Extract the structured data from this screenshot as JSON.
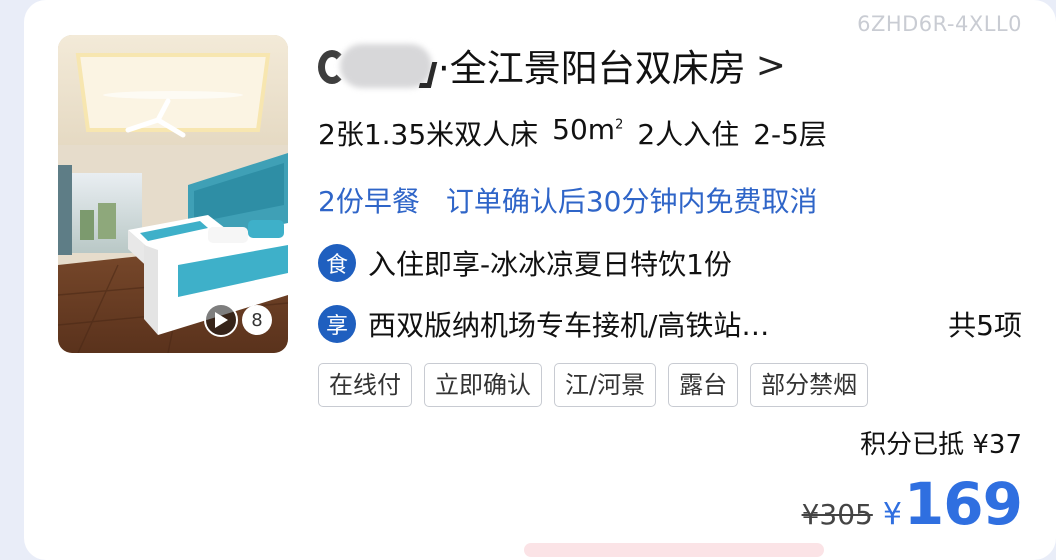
{
  "watermark": "6ZHD6R-4XLL0",
  "room": {
    "photo_count": "8",
    "title_suffix": "·全江景阳台双床房",
    "chevron": ">",
    "specs": {
      "beds": "2张1.35米双人床",
      "area": "50m",
      "area_unit_sup": "2",
      "guests": "2人入住",
      "floors": "2-5层"
    },
    "benefits": {
      "breakfast": "2份早餐",
      "cancellation": "订单确认后30分钟内免费取消"
    },
    "perks": [
      {
        "badge": "食",
        "text": "入住即享-冰冰凉夏日特饮1份",
        "more": ""
      },
      {
        "badge": "享",
        "text": "西双版纳机场专车接机/高铁站…",
        "more": "共5项"
      }
    ],
    "tags": [
      "在线付",
      "立即确认",
      "江/河景",
      "露台",
      "部分禁烟"
    ],
    "points_text": "积分已抵 ¥37",
    "original_price": "¥305",
    "currency_symbol": "¥",
    "current_price": "169"
  },
  "colors": {
    "accent_blue": "#2f6fe0",
    "benefit_blue": "#2f65c8",
    "badge_blue": "#1f5fbf"
  },
  "icons": {
    "play": "play-icon",
    "food": "food-badge-icon",
    "perk": "perk-badge-icon",
    "chevron": "chevron-right-icon"
  }
}
